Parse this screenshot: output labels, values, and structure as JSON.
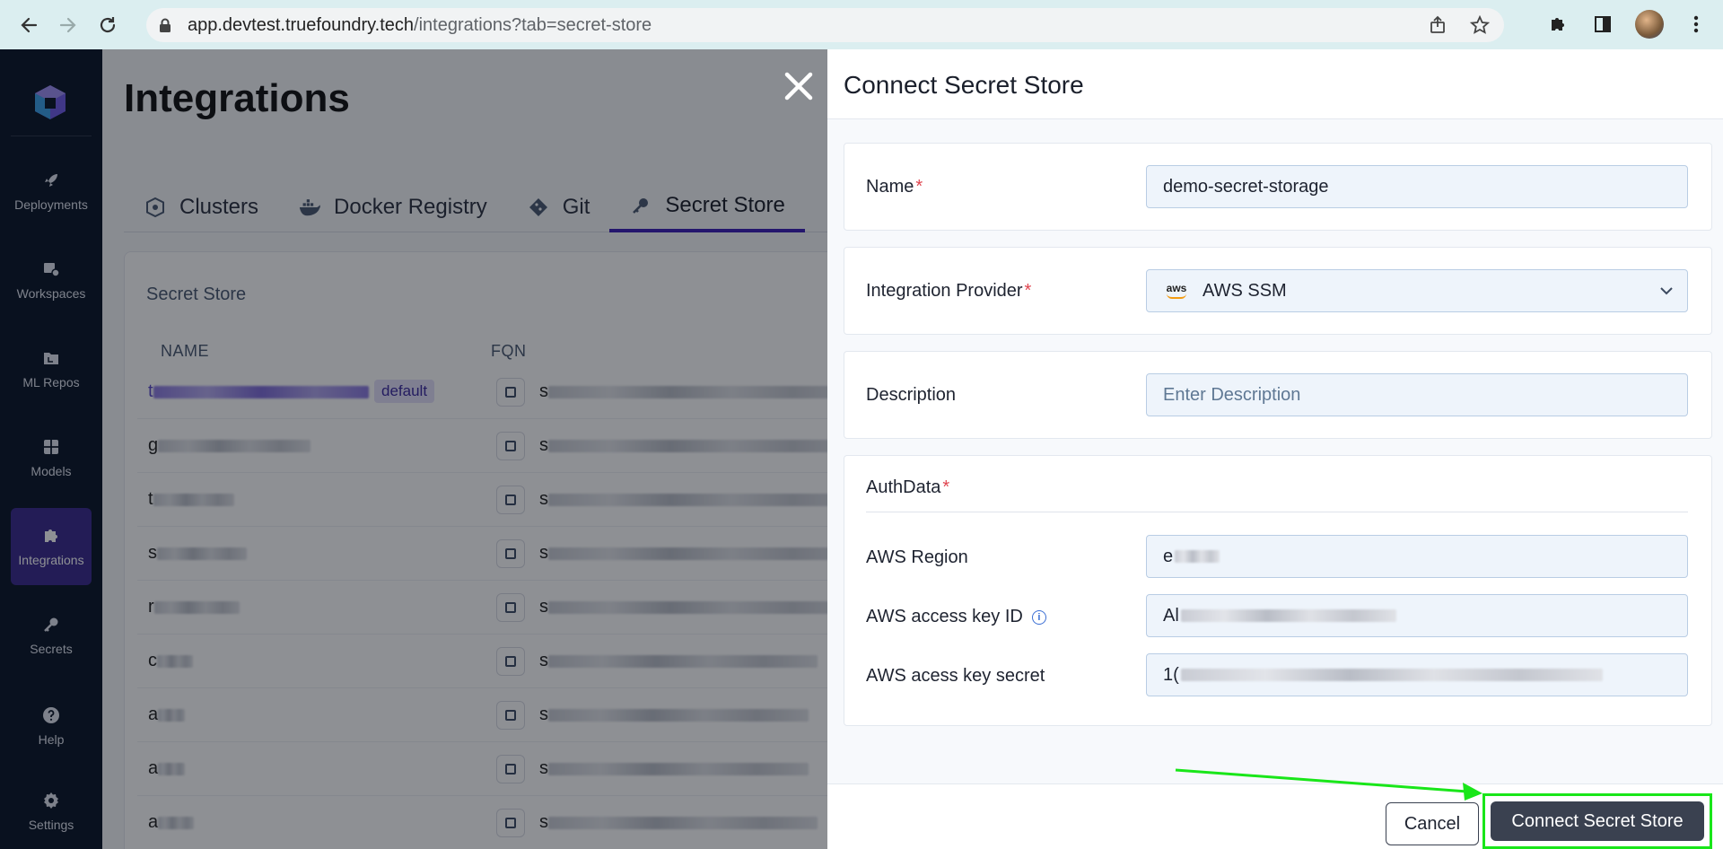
{
  "browser": {
    "url_host": "app.devtest.truefoundry.tech",
    "url_path": "/integrations?tab=secret-store"
  },
  "sidebar": {
    "items": [
      {
        "label": "Deployments",
        "icon": "rocket-icon"
      },
      {
        "label": "Workspaces",
        "icon": "workspaces-icon"
      },
      {
        "label": "ML Repos",
        "icon": "folder-icon"
      },
      {
        "label": "Models",
        "icon": "grid-icon"
      },
      {
        "label": "Integrations",
        "icon": "puzzle-icon",
        "active": true
      },
      {
        "label": "Secrets",
        "icon": "key-icon"
      },
      {
        "label": "Help",
        "icon": "help-icon"
      },
      {
        "label": "Settings",
        "icon": "gear-icon"
      }
    ]
  },
  "page": {
    "title": "Integrations",
    "tabs": [
      {
        "label": "Clusters",
        "icon": "helm-icon"
      },
      {
        "label": "Docker Registry",
        "icon": "docker-icon"
      },
      {
        "label": "Git",
        "icon": "git-icon"
      },
      {
        "label": "Secret Store",
        "icon": "key-icon",
        "active": true
      }
    ],
    "card_title": "Secret Store",
    "columns": [
      "NAME",
      "FQN"
    ],
    "rows": [
      {
        "name": "t",
        "badge": "default",
        "fqn": "s"
      },
      {
        "name": "g",
        "fqn": "s"
      },
      {
        "name": "t",
        "fqn": "s"
      },
      {
        "name": "s",
        "fqn": "s"
      },
      {
        "name": "r",
        "fqn": "s"
      },
      {
        "name": "c",
        "fqn": "s"
      },
      {
        "name": "a",
        "fqn": "s"
      },
      {
        "name": "a",
        "fqn": "s"
      },
      {
        "name": "a",
        "fqn": "s"
      }
    ]
  },
  "drawer": {
    "title": "Connect Secret Store",
    "name_label": "Name",
    "name_value": "demo-secret-storage",
    "provider_label": "Integration Provider",
    "provider_value": "AWS SSM",
    "provider_logo_text": "aws",
    "description_label": "Description",
    "description_placeholder": "Enter Description",
    "authdata_label": "AuthData",
    "region_label": "AWS Region",
    "region_value": "e",
    "access_key_label": "AWS access key ID",
    "access_key_value": "Al",
    "secret_label": "AWS acess key secret",
    "secret_value": "1(",
    "cancel_label": "Cancel",
    "connect_label": "Connect Secret Store"
  },
  "colors": {
    "sidebar_bg": "#0b1527",
    "active_accent": "#3b1fb8",
    "highlight_box": "#19e619",
    "primary_button": "#3a4150"
  }
}
